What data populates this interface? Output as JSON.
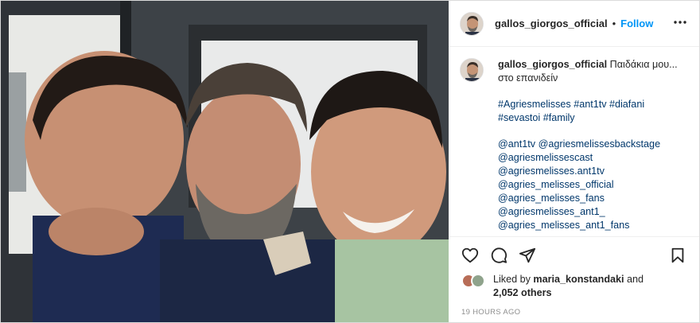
{
  "post": {
    "username": "gallos_giorgos_official",
    "separator": "•",
    "follow_label": "Follow",
    "more_label": "•••",
    "caption": {
      "username": "gallos_giorgos_official",
      "text": "Παιδάκια μου... στο επανιδείν",
      "hashtags": [
        "#Agriesmelisses",
        "#ant1tv",
        "#diafani",
        "#sevastoi",
        "#family"
      ],
      "mentions": [
        "@ant1tv @agriesmelissesbackstage",
        "@agriesmelissescast",
        "@agriesmelisses.ant1tv",
        "@agries_melisses_official",
        "@agries_melisses_fans",
        "@agriesmelisses_ant1_",
        "@agries_melisses_ant1_fans"
      ]
    },
    "actions": {
      "like_icon": "heart-icon",
      "comment_icon": "comment-icon",
      "share_icon": "send-icon",
      "save_icon": "bookmark-icon"
    },
    "likes": {
      "prefix": "Liked by",
      "user": "maria_konstandaki",
      "conjunction": "and",
      "count": "2,052 others"
    },
    "timestamp": "19 HOURS AGO"
  },
  "colors": {
    "link": "#00376b",
    "follow": "#0095f6",
    "muted": "#8e8e8e",
    "border": "#dbdbdb"
  }
}
